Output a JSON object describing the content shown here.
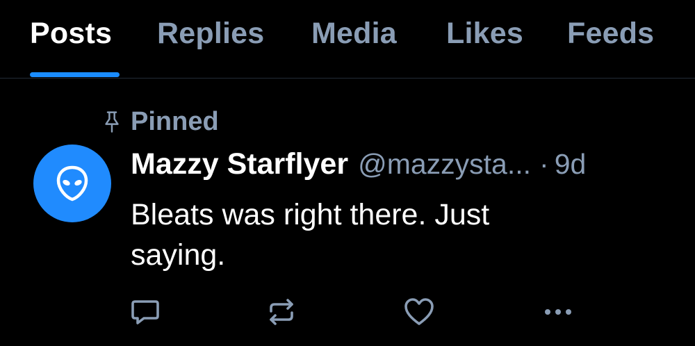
{
  "tabs": [
    {
      "label": "Posts",
      "active": true
    },
    {
      "label": "Replies",
      "active": false
    },
    {
      "label": "Media",
      "active": false
    },
    {
      "label": "Likes",
      "active": false
    },
    {
      "label": "Feeds",
      "active": false
    }
  ],
  "post": {
    "pinned_label": "Pinned",
    "author_name": "Mazzy Starflyer",
    "author_handle": "@mazzysta...",
    "separator": "·",
    "timestamp": "9d",
    "text": "Bleats was right there. Just saying.",
    "avatar_icon": "alien-icon",
    "avatar_color": "#208bfe"
  },
  "actions": {
    "reply_icon": "reply-icon",
    "repost_icon": "repost-icon",
    "like_icon": "heart-icon",
    "more_icon": "more-icon"
  },
  "colors": {
    "background": "#000000",
    "accent": "#1a8cff",
    "muted": "#8a9db5",
    "text": "#ffffff"
  }
}
